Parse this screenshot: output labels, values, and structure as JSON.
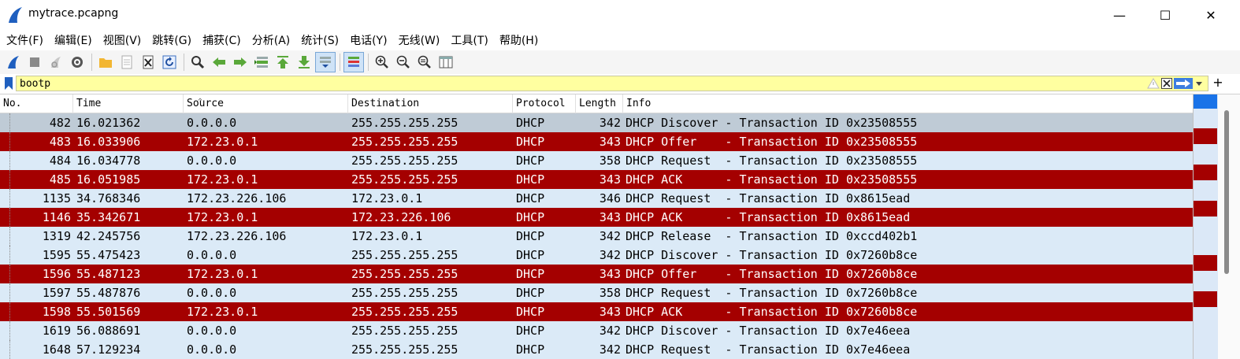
{
  "window": {
    "title": "mytrace.pcapng",
    "min_symbol": "—",
    "max_symbol": "☐",
    "close_symbol": "✕"
  },
  "menu": [
    "文件(F)",
    "编辑(E)",
    "视图(V)",
    "跳转(G)",
    "捕获(C)",
    "分析(A)",
    "统计(S)",
    "电话(Y)",
    "无线(W)",
    "工具(T)",
    "帮助(H)"
  ],
  "filter": {
    "value": "bootp",
    "plus": "+"
  },
  "columns": {
    "no": "No.",
    "time": "Time",
    "source": "Source",
    "destination": "Destination",
    "protocol": "Protocol",
    "length": "Length",
    "info": "Info"
  },
  "colors": {
    "row_light": "#dbeaf7",
    "row_red": "#a40000",
    "row_selected": "#bfcbd6",
    "text_light": "#000000",
    "text_red": "#ffffff"
  },
  "packets": [
    {
      "no": "482",
      "time": "16.021362",
      "source": "0.0.0.0",
      "destination": "255.255.255.255",
      "protocol": "DHCP",
      "length": "342",
      "info": "DHCP Discover - Transaction ID 0x23508555",
      "style": "selected"
    },
    {
      "no": "483",
      "time": "16.033906",
      "source": "172.23.0.1",
      "destination": "255.255.255.255",
      "protocol": "DHCP",
      "length": "343",
      "info": "DHCP Offer    - Transaction ID 0x23508555",
      "style": "red"
    },
    {
      "no": "484",
      "time": "16.034778",
      "source": "0.0.0.0",
      "destination": "255.255.255.255",
      "protocol": "DHCP",
      "length": "358",
      "info": "DHCP Request  - Transaction ID 0x23508555",
      "style": "light"
    },
    {
      "no": "485",
      "time": "16.051985",
      "source": "172.23.0.1",
      "destination": "255.255.255.255",
      "protocol": "DHCP",
      "length": "343",
      "info": "DHCP ACK      - Transaction ID 0x23508555",
      "style": "red"
    },
    {
      "no": "1135",
      "time": "34.768346",
      "source": "172.23.226.106",
      "destination": "172.23.0.1",
      "protocol": "DHCP",
      "length": "346",
      "info": "DHCP Request  - Transaction ID 0x8615ead",
      "style": "light"
    },
    {
      "no": "1146",
      "time": "35.342671",
      "source": "172.23.0.1",
      "destination": "172.23.226.106",
      "protocol": "DHCP",
      "length": "343",
      "info": "DHCP ACK      - Transaction ID 0x8615ead",
      "style": "red"
    },
    {
      "no": "1319",
      "time": "42.245756",
      "source": "172.23.226.106",
      "destination": "172.23.0.1",
      "protocol": "DHCP",
      "length": "342",
      "info": "DHCP Release  - Transaction ID 0xccd402b1",
      "style": "light"
    },
    {
      "no": "1595",
      "time": "55.475423",
      "source": "0.0.0.0",
      "destination": "255.255.255.255",
      "protocol": "DHCP",
      "length": "342",
      "info": "DHCP Discover - Transaction ID 0x7260b8ce",
      "style": "light"
    },
    {
      "no": "1596",
      "time": "55.487123",
      "source": "172.23.0.1",
      "destination": "255.255.255.255",
      "protocol": "DHCP",
      "length": "343",
      "info": "DHCP Offer    - Transaction ID 0x7260b8ce",
      "style": "red"
    },
    {
      "no": "1597",
      "time": "55.487876",
      "source": "0.0.0.0",
      "destination": "255.255.255.255",
      "protocol": "DHCP",
      "length": "358",
      "info": "DHCP Request  - Transaction ID 0x7260b8ce",
      "style": "light"
    },
    {
      "no": "1598",
      "time": "55.501569",
      "source": "172.23.0.1",
      "destination": "255.255.255.255",
      "protocol": "DHCP",
      "length": "343",
      "info": "DHCP ACK      - Transaction ID 0x7260b8ce",
      "style": "red"
    },
    {
      "no": "1619",
      "time": "56.088691",
      "source": "0.0.0.0",
      "destination": "255.255.255.255",
      "protocol": "DHCP",
      "length": "342",
      "info": "DHCP Discover - Transaction ID 0x7e46eea",
      "style": "light"
    },
    {
      "no": "1648",
      "time": "57.129234",
      "source": "0.0.0.0",
      "destination": "255.255.255.255",
      "protocol": "DHCP",
      "length": "342",
      "info": "DHCP Request  - Transaction ID 0x7e46eea",
      "style": "light"
    }
  ]
}
